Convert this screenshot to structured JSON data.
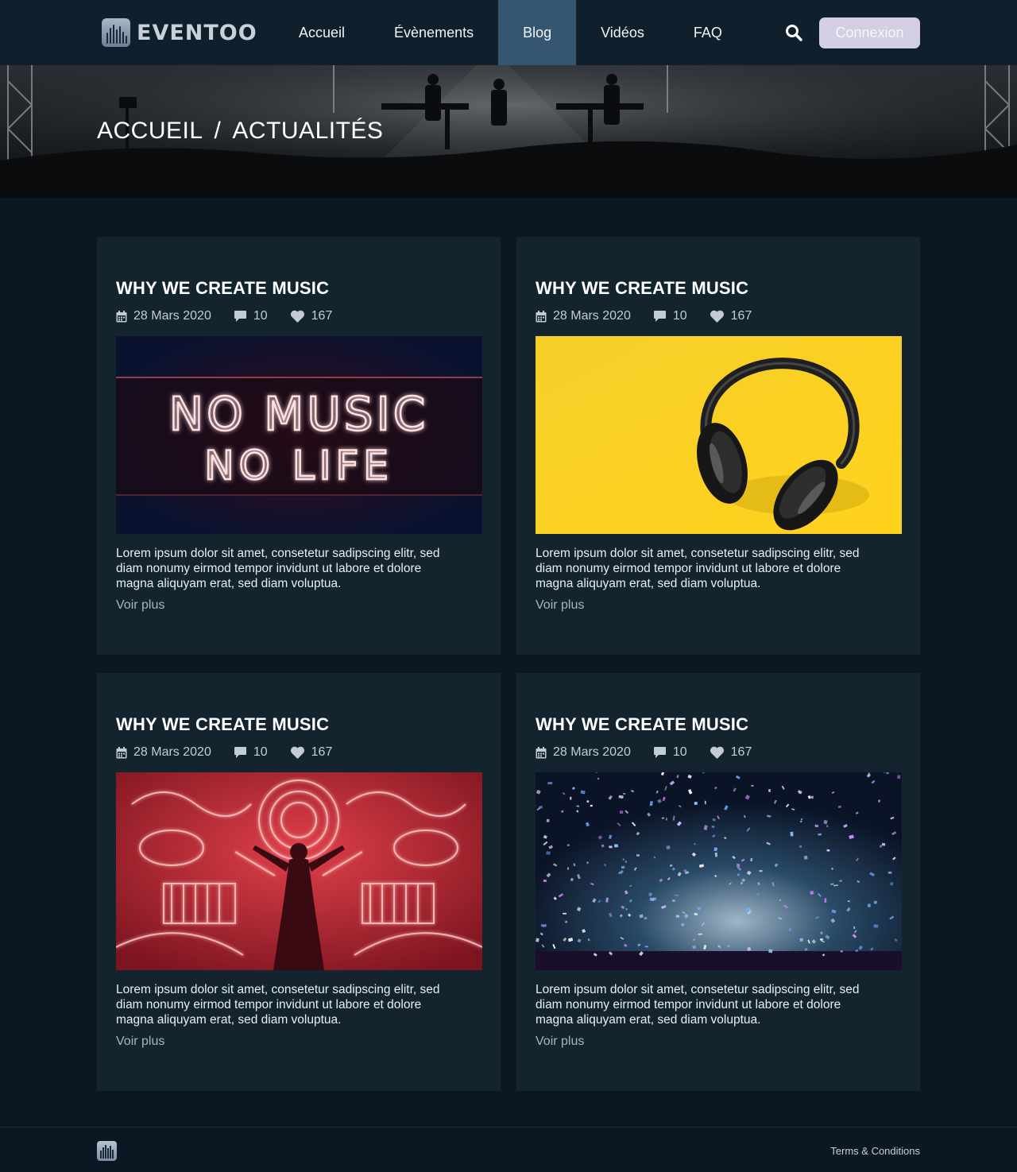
{
  "header": {
    "logo_text": "EVENTOO",
    "nav": [
      {
        "label": "Accueil",
        "active": false
      },
      {
        "label": "Évènements",
        "active": false
      },
      {
        "label": "Blog",
        "active": true
      },
      {
        "label": "Vidéos",
        "active": false
      },
      {
        "label": "FAQ",
        "active": false
      }
    ],
    "search_icon": "search-icon",
    "login_label": "Connexion"
  },
  "hero": {
    "breadcrumb_home": "ACCUEIL",
    "breadcrumb_separator": "/",
    "breadcrumb_current": "ACTUALITÉS"
  },
  "posts": [
    {
      "title": "WHY WE CREATE MUSIC",
      "date": "28 Mars 2020",
      "comments": "10",
      "likes": "167",
      "image": "neon-no-music-no-life",
      "image_text_line1": "NO MUSIC",
      "image_text_line2": "NO LIFE",
      "excerpt": "Lorem ipsum dolor sit amet, consetetur sadipscing elitr, sed diam nonumy eirmod tempor invidunt ut labore et dolore magna aliquyam erat, sed diam voluptua.",
      "link": "Voir plus"
    },
    {
      "title": "WHY WE CREATE MUSIC",
      "date": "28 Mars 2020",
      "comments": "10",
      "likes": "167",
      "image": "headphones-yellow",
      "excerpt": "Lorem ipsum dolor sit amet, consetetur sadipscing elitr, sed diam nonumy eirmod tempor invidunt ut labore et dolore magna aliquyam erat, sed diam voluptua.",
      "link": "Voir plus"
    },
    {
      "title": "WHY WE CREATE MUSIC",
      "date": "28 Mars 2020",
      "comments": "10",
      "likes": "167",
      "image": "neon-instruments-red",
      "excerpt": "Lorem ipsum dolor sit amet, consetetur sadipscing elitr, sed diam nonumy eirmod tempor invidunt ut labore et dolore magna aliquyam erat, sed diam voluptua.",
      "link": "Voir plus"
    },
    {
      "title": "WHY WE CREATE MUSIC",
      "date": "28 Mars 2020",
      "comments": "10",
      "likes": "167",
      "image": "confetti-concert",
      "excerpt": "Lorem ipsum dolor sit amet, consetetur sadipscing elitr, sed diam nonumy eirmod tempor invidunt ut labore et dolore magna aliquyam erat, sed diam voluptua.",
      "link": "Voir plus"
    }
  ],
  "footer": {
    "terms_label": "Terms & Conditions"
  },
  "colors": {
    "page_bg": "#0b1722",
    "header_bg": "#0f1f2c",
    "nav_active_bg": "#365570",
    "card_bg": "#13242f",
    "login_bg": "#d3cfe2"
  }
}
